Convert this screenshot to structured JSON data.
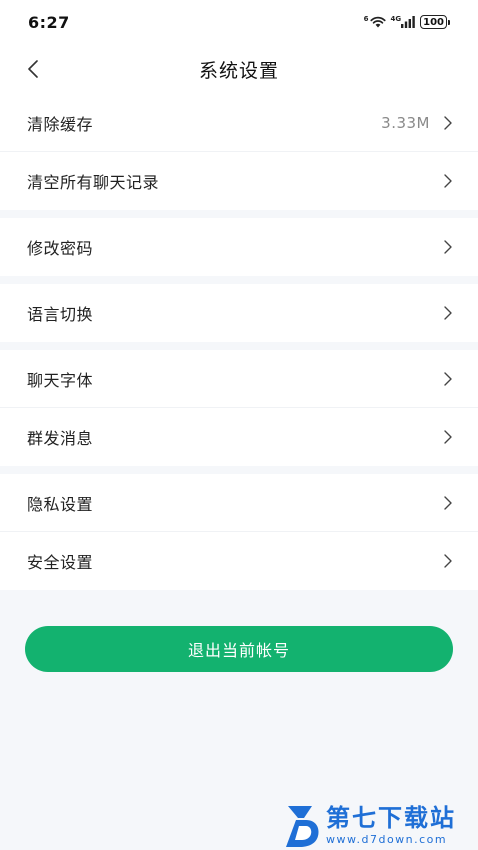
{
  "status_bar": {
    "time": "6:27",
    "network": "4G",
    "wifi_badge": "6",
    "battery": "100"
  },
  "header": {
    "title": "系统设置"
  },
  "settings": {
    "clear_cache": {
      "label": "清除缓存",
      "value": "3.33M"
    },
    "clear_chats": {
      "label": "清空所有聊天记录"
    },
    "change_password": {
      "label": "修改密码"
    },
    "language": {
      "label": "语言切换"
    },
    "chat_font": {
      "label": "聊天字体"
    },
    "broadcast": {
      "label": "群发消息"
    },
    "privacy": {
      "label": "隐私设置"
    },
    "security": {
      "label": "安全设置"
    }
  },
  "logout_label": "退出当前帐号",
  "watermark": {
    "title": "第七下载站",
    "url": "www.d7down.com"
  },
  "colors": {
    "accent": "#13b26f",
    "page_bg": "#f5f7fa",
    "watermark": "#1f6fd6"
  }
}
